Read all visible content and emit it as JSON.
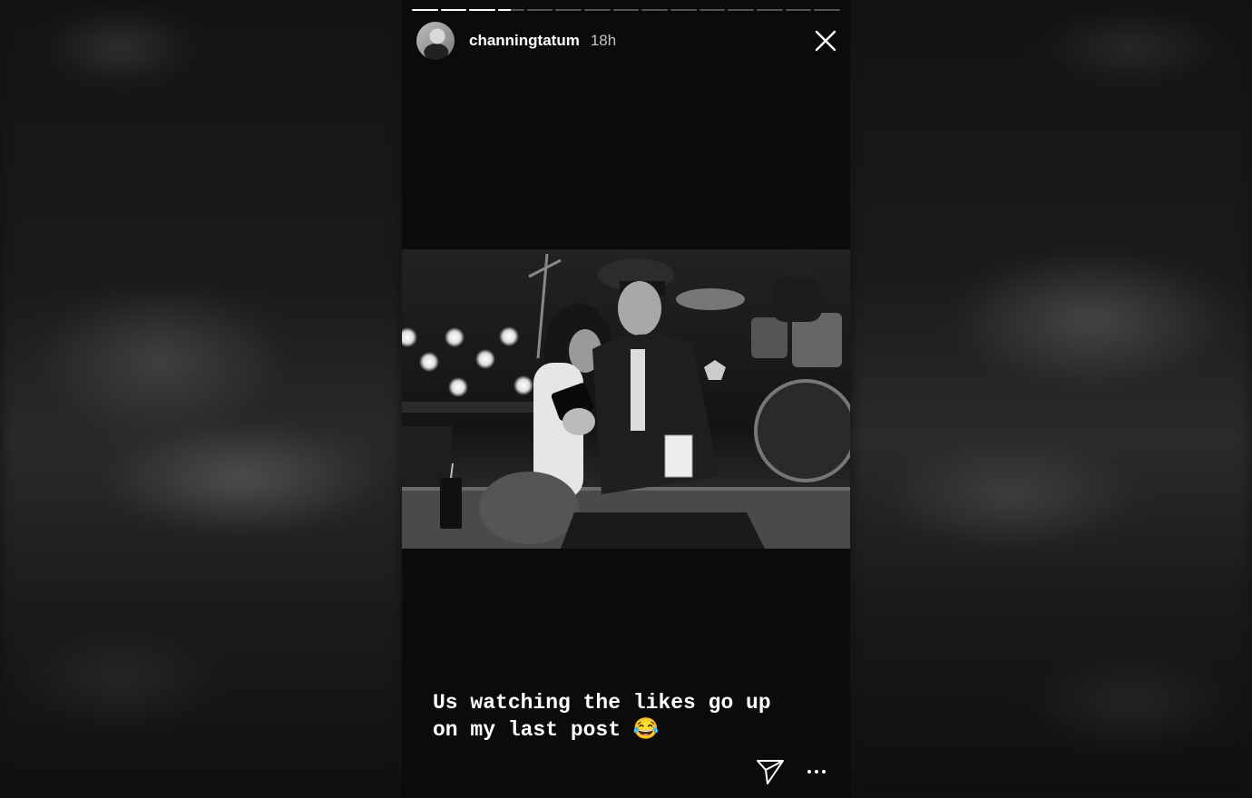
{
  "story": {
    "username": "channingtatum",
    "time": "18h",
    "caption": "Us watching the likes go up\non my last post 😂",
    "progress": {
      "segment_count": 15,
      "completed": 3,
      "current_fraction": 0.5
    }
  },
  "icons": {
    "close": "close-icon",
    "send": "paper-plane-icon",
    "more": "more-options-icon"
  }
}
